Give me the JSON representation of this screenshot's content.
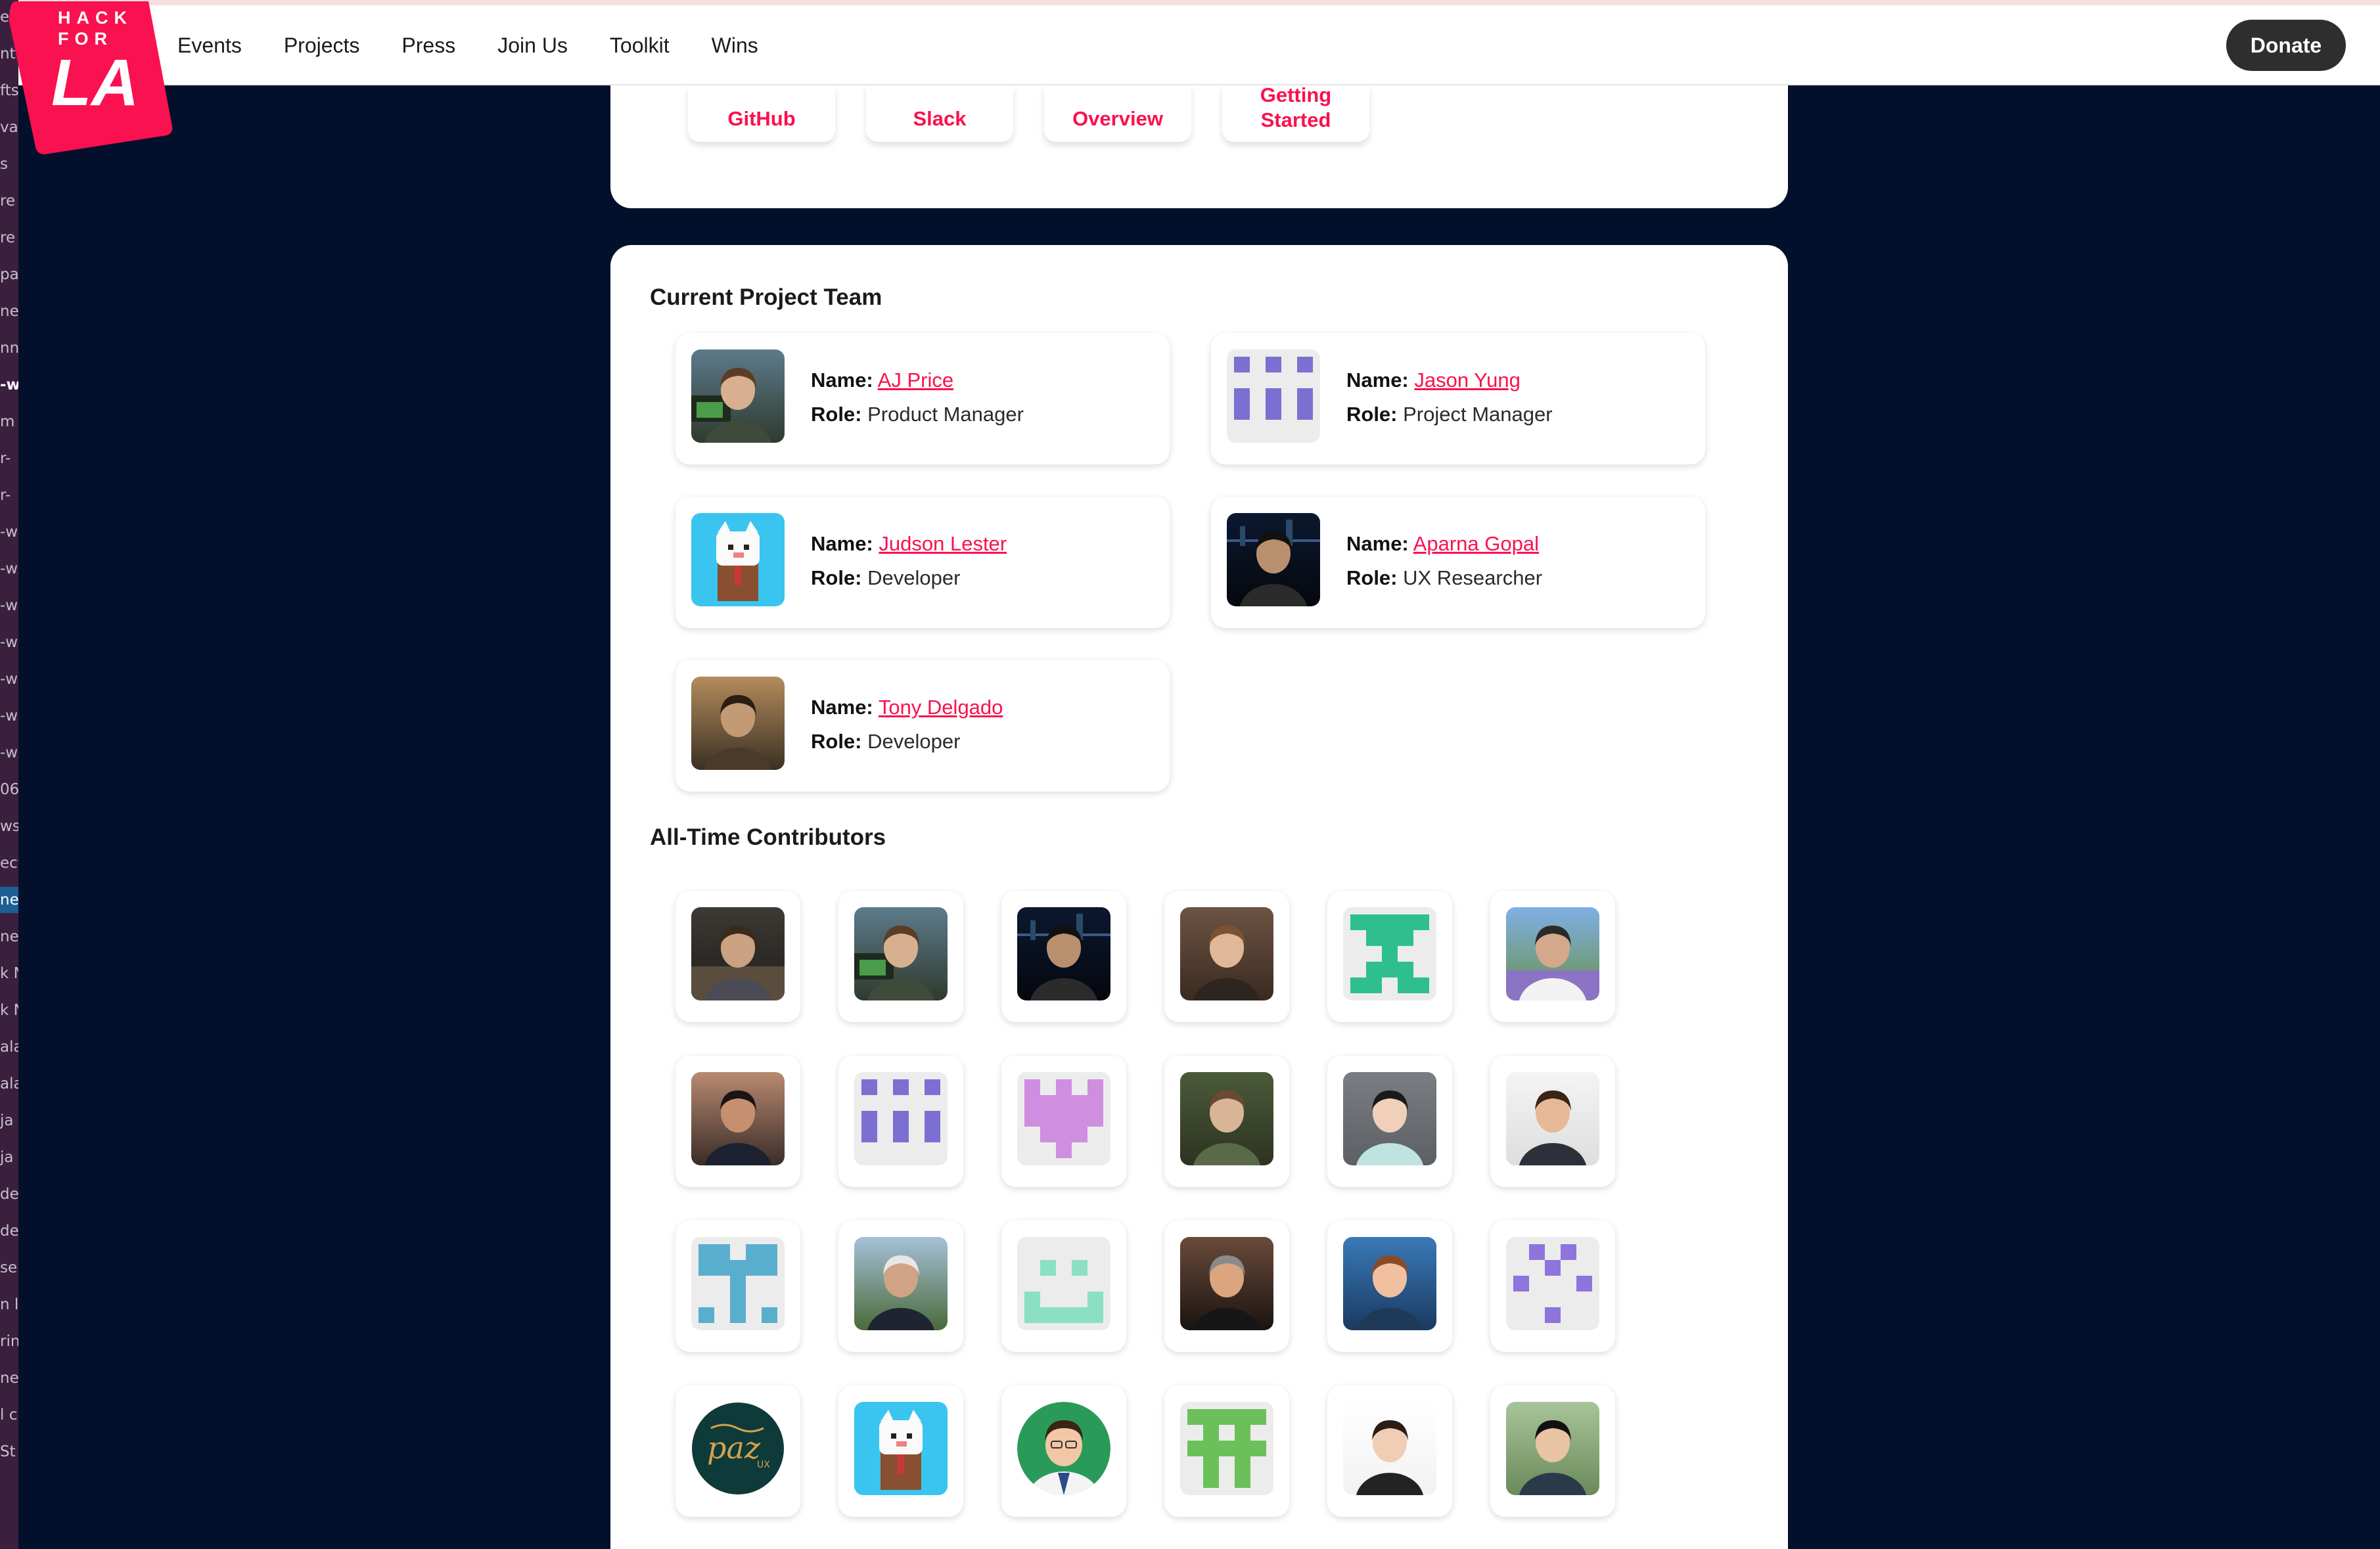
{
  "nav": {
    "items": [
      "Events",
      "Projects",
      "Press",
      "Join Us",
      "Toolkit",
      "Wins"
    ],
    "donate_label": "Donate"
  },
  "logo": {
    "text_top": "HACK",
    "text_mid": "FOR",
    "text_main": "LA",
    "color": "#fa114f"
  },
  "resources": {
    "buttons": [
      {
        "label": "GitHub"
      },
      {
        "label": "Slack"
      },
      {
        "label": "Overview"
      },
      {
        "label": "Getting Started"
      }
    ]
  },
  "team": {
    "title": "Current Project Team",
    "name_label": "Name:",
    "role_label": "Role:",
    "members": [
      {
        "name": "AJ Price",
        "role": "Product Manager",
        "avatar": "photo-office"
      },
      {
        "name": "Jason Yung",
        "role": "Project Manager",
        "avatar": "identicon-purple"
      },
      {
        "name": "Judson Lester",
        "role": "Developer",
        "avatar": "cartoon-cat"
      },
      {
        "name": "Aparna Gopal",
        "role": "UX Researcher",
        "avatar": "photo-night-city"
      },
      {
        "name": "Tony Delgado",
        "role": "Developer",
        "avatar": "photo-sunglasses"
      }
    ]
  },
  "contributors": {
    "title": "All-Time Contributors",
    "avatars": [
      "photo-forest-path",
      "photo-office",
      "photo-night-city",
      "photo-smiling-woman",
      "identicon-green",
      "photo-flowers-bridge",
      "photo-woman-dark-hair",
      "identicon-purple",
      "identicon-pink",
      "photo-woman-leaves",
      "photo-woman-gray-bg",
      "photo-woman-smile",
      "identicon-blue",
      "photo-man-cap",
      "identicon-mint",
      "photo-man-glasses",
      "photo-woman-red",
      "identicon-violet",
      "logo-paz-ux",
      "cartoon-cat",
      "illustration-man",
      "identicon-lime",
      "photo-woman-white-bg",
      "photo-man-outdoor"
    ]
  },
  "sidebar_fragments": [
    "ect",
    "nti",
    "fts",
    "va",
    "s",
    "re",
    "re",
    "pal",
    "ne",
    "nn",
    "-w",
    "m",
    "r-",
    "r-",
    "-w",
    "-w",
    "-w",
    "-w",
    "-w",
    "-w",
    "-w",
    "06",
    "ws",
    "ect",
    "ne",
    "ne",
    "k N",
    "k N",
    "ala",
    "ala",
    "ja",
    "ja",
    "de",
    "de",
    "se",
    "n l",
    "rin",
    "ne",
    "l c",
    "St"
  ],
  "colors": {
    "accent": "#fa114f",
    "page_bg": "#03102b",
    "card_bg": "#ffffff"
  }
}
